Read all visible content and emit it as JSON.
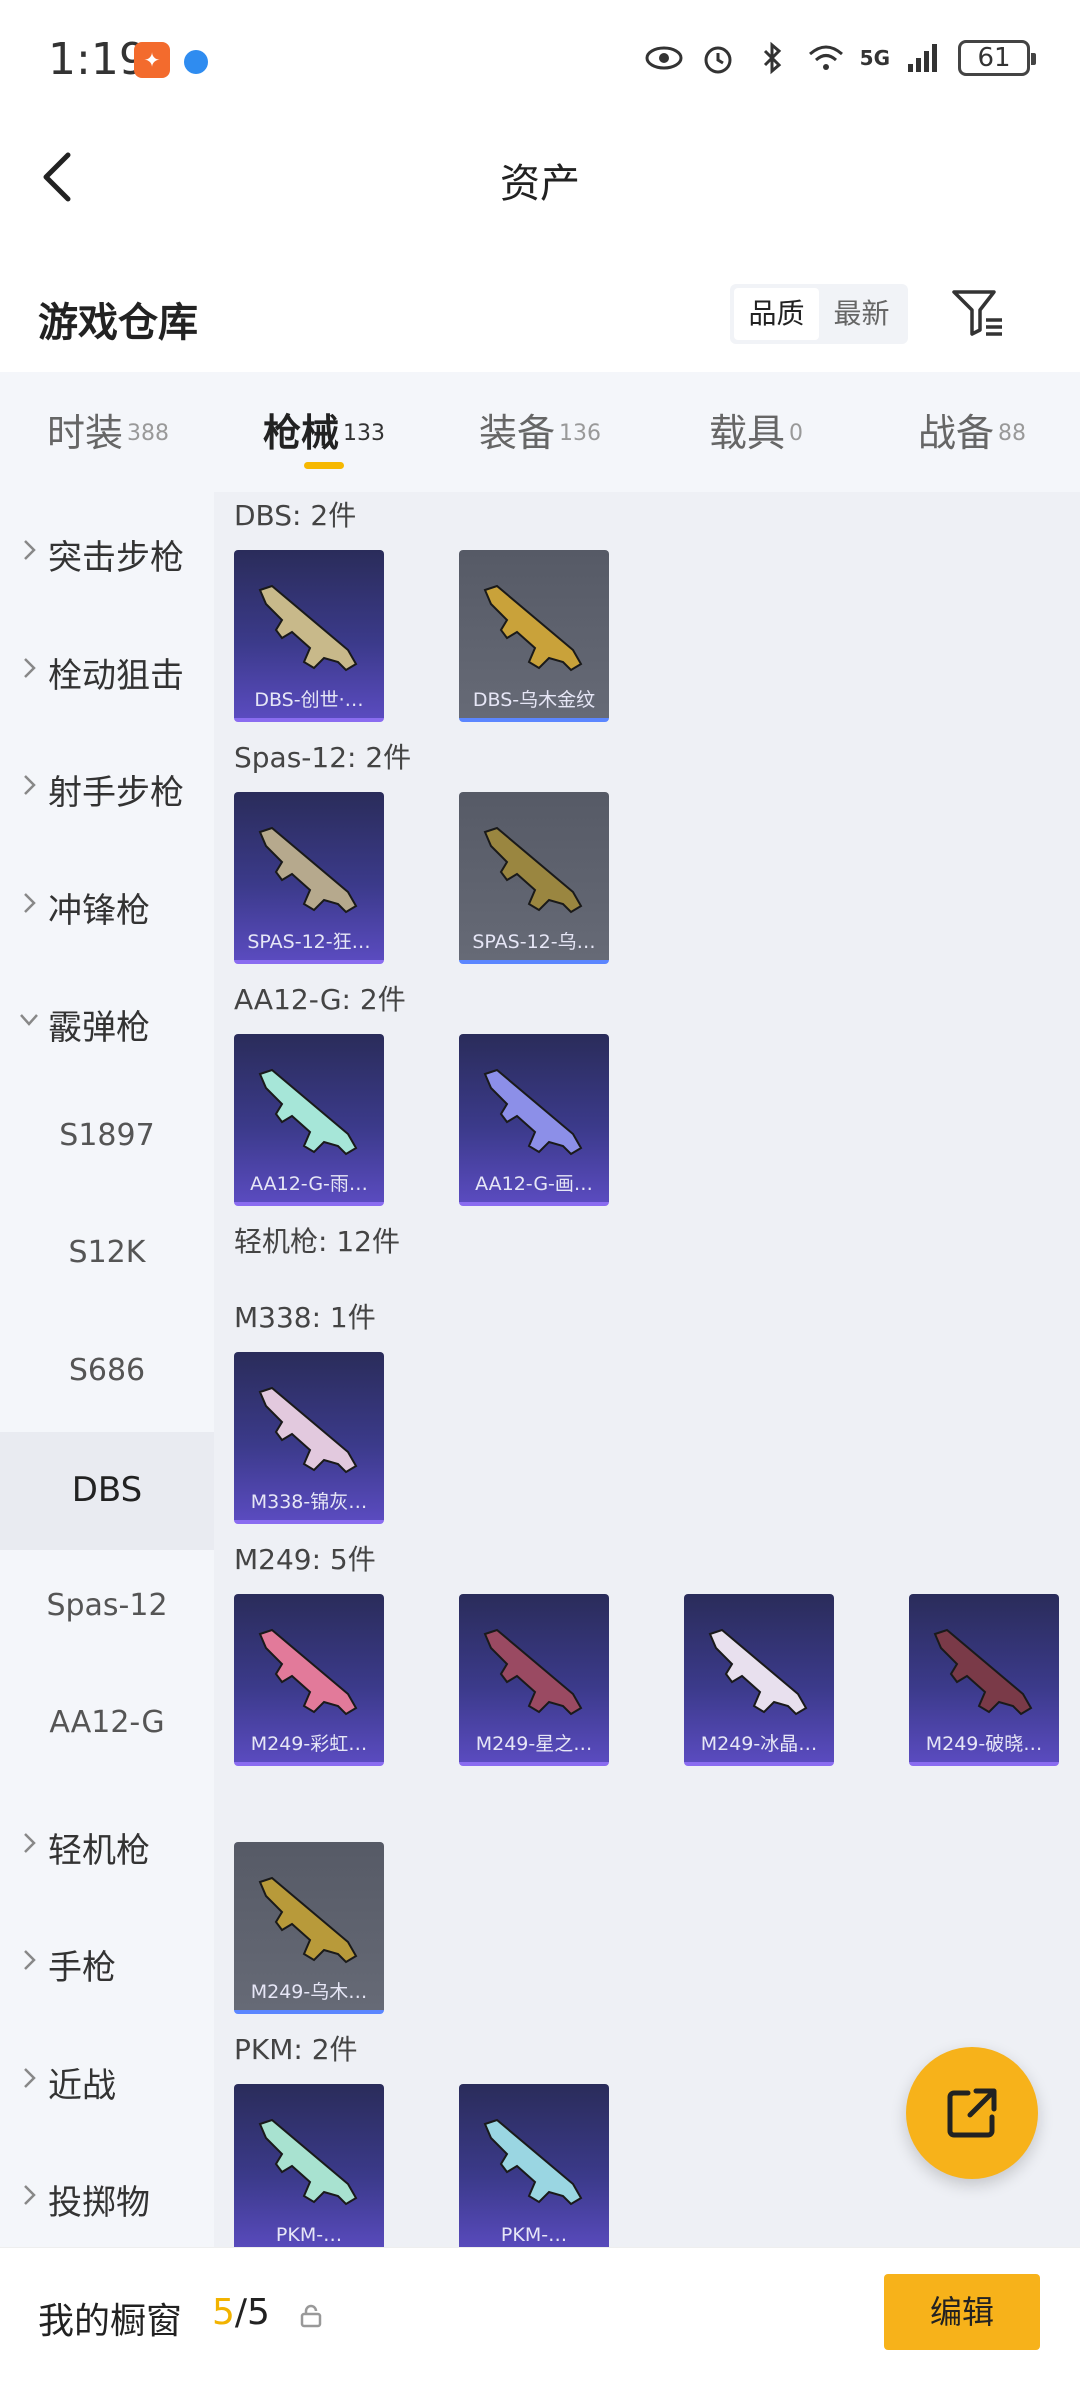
{
  "status_bar": {
    "time": "1:19",
    "network": "5G",
    "battery": "61"
  },
  "header": {
    "title": "资产"
  },
  "warehouse": {
    "title": "游戏仓库",
    "sort_options": [
      "品质",
      "最新"
    ],
    "sort_selected": "品质"
  },
  "tabs": [
    {
      "label": "时装",
      "count": "388"
    },
    {
      "label": "枪械",
      "count": "133"
    },
    {
      "label": "装备",
      "count": "136"
    },
    {
      "label": "载具",
      "count": "0"
    },
    {
      "label": "战备",
      "count": "88"
    }
  ],
  "active_tab": "枪械",
  "sidebar": {
    "items": [
      {
        "label": "突击步枪",
        "type": "category",
        "expanded": false
      },
      {
        "label": "栓动狙击",
        "type": "category",
        "expanded": false
      },
      {
        "label": "射手步枪",
        "type": "category",
        "expanded": false
      },
      {
        "label": "冲锋枪",
        "type": "category",
        "expanded": false
      },
      {
        "label": "霰弹枪",
        "type": "category",
        "expanded": true
      },
      {
        "label": "S1897",
        "type": "sub"
      },
      {
        "label": "S12K",
        "type": "sub"
      },
      {
        "label": "S686",
        "type": "sub"
      },
      {
        "label": "DBS",
        "type": "sub",
        "selected": true
      },
      {
        "label": "Spas-12",
        "type": "sub"
      },
      {
        "label": "AA12-G",
        "type": "sub"
      },
      {
        "label": "轻机枪",
        "type": "category",
        "expanded": false
      },
      {
        "label": "手枪",
        "type": "category",
        "expanded": false
      },
      {
        "label": "近战",
        "type": "category",
        "expanded": false
      },
      {
        "label": "投掷物",
        "type": "category",
        "expanded": false
      }
    ]
  },
  "sections": [
    {
      "header": "DBS: 2件",
      "items": [
        {
          "name": "DBS-创世·…",
          "style": "purple",
          "gun": "#c8b98a"
        },
        {
          "name": "DBS-乌木金纹",
          "style": "gray",
          "gun": "#c9a23a"
        }
      ]
    },
    {
      "header": "Spas-12: 2件",
      "items": [
        {
          "name": "SPAS-12-狂…",
          "style": "purple",
          "gun": "#b6a98d"
        },
        {
          "name": "SPAS-12-乌…",
          "style": "gray",
          "gun": "#9a8640"
        }
      ]
    },
    {
      "header": "AA12-G: 2件",
      "items": [
        {
          "name": "AA12-G-雨…",
          "style": "purple",
          "gun": "#a6e6d8"
        },
        {
          "name": "AA12-G-画…",
          "style": "purple",
          "gun": "#8c8fe8"
        }
      ]
    },
    {
      "header": "轻机枪: 12件",
      "items": []
    },
    {
      "header": "M338: 1件",
      "items": [
        {
          "name": "M338-锦灰…",
          "style": "purple",
          "gun": "#e2c9de"
        }
      ]
    },
    {
      "header": "M249: 5件",
      "items": [
        {
          "name": "M249-彩虹…",
          "style": "purple",
          "gun": "#e27a9a"
        },
        {
          "name": "M249-星之…",
          "style": "purple",
          "gun": "#9a4a62"
        },
        {
          "name": "M249-冰晶…",
          "style": "purple",
          "gun": "#e8e0ee"
        },
        {
          "name": "M249-破晓…",
          "style": "purple",
          "gun": "#7a3a48"
        },
        {
          "name": "M249-乌木…",
          "style": "gray",
          "gun": "#b89a3a"
        }
      ]
    },
    {
      "header": "PKM: 2件",
      "items": [
        {
          "name": "PKM-…",
          "style": "purple",
          "gun": "#a8e2d0"
        },
        {
          "name": "PKM-…",
          "style": "purple",
          "gun": "#9ad6e2"
        }
      ]
    }
  ],
  "bottom_bar": {
    "label": "我的橱窗",
    "current": "5",
    "slash": "/",
    "total": "5",
    "edit_label": "编辑"
  },
  "colors": {
    "accent": "#f7b21a",
    "purple_card": "#3b3a8a",
    "gray_card": "#666a76"
  }
}
